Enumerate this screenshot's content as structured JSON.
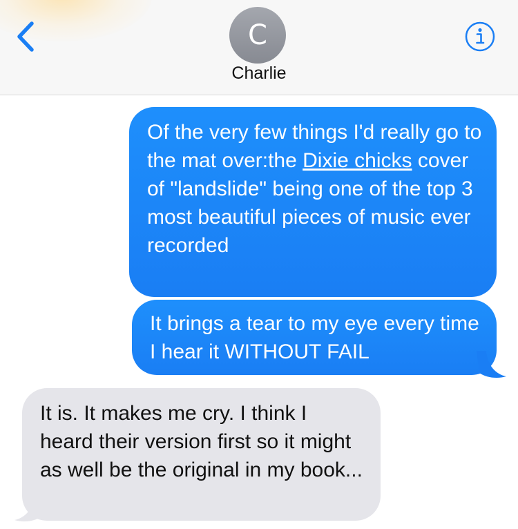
{
  "header": {
    "contact_initial": "C",
    "contact_name": "Charlie",
    "back_icon": "chevron-left-icon",
    "info_icon": "info-icon",
    "accent_color": "#1a7ef4"
  },
  "messages": [
    {
      "direction": "sent",
      "before_link": "Of the very few things I'd really go to the mat over:the ",
      "link_text": "Dixie chicks",
      "after_link": " cover of \"landslide\" being one of the top 3 most beautiful pieces of music ever recorded"
    },
    {
      "direction": "sent",
      "text": "It brings a tear to my eye every time I hear it WITHOUT FAIL"
    },
    {
      "direction": "received",
      "text": "It is. It makes me cry. I think I heard their version first so it might as well be the original in my book..."
    }
  ],
  "colors": {
    "sent_bubble": "#1a7ef4",
    "received_bubble": "#e5e5ea"
  }
}
